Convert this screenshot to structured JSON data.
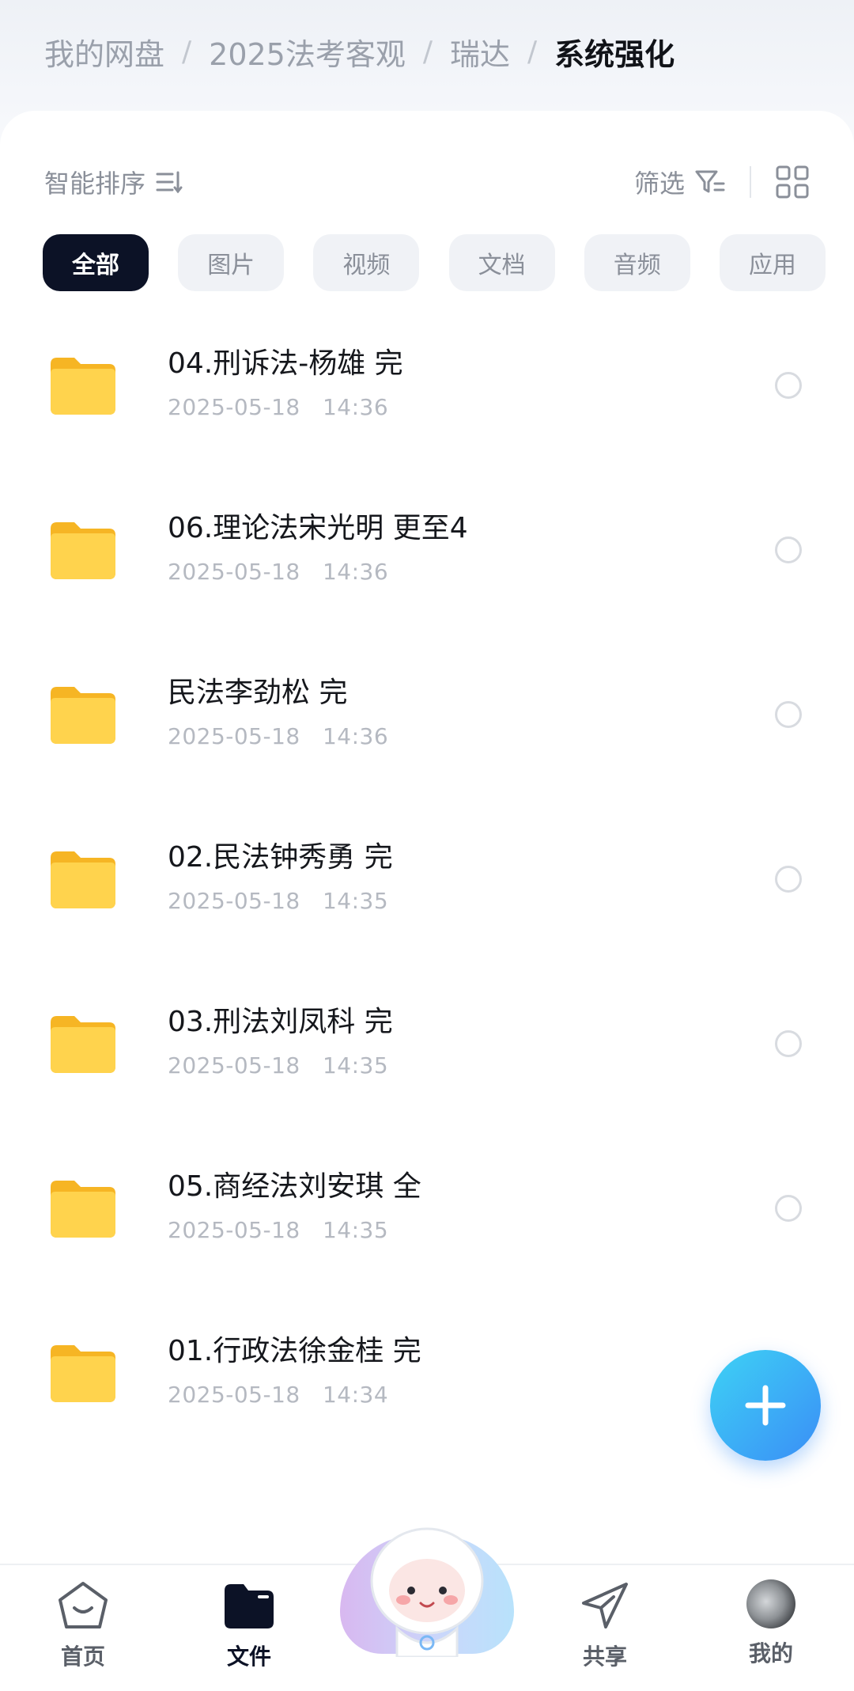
{
  "breadcrumb": {
    "items": [
      "我的网盘",
      "2025法考客观",
      "瑞达"
    ],
    "separator": "/",
    "current": "系统强化"
  },
  "toolbar": {
    "sort_label": "智能排序",
    "filter_label": "筛选"
  },
  "chips": [
    "全部",
    "图片",
    "视频",
    "文档",
    "音频",
    "应用"
  ],
  "files": [
    {
      "name": "04.刑诉法-杨雄 完",
      "date": "2025-05-18",
      "time": "14:36"
    },
    {
      "name": "06.理论法宋光明 更至4",
      "date": "2025-05-18",
      "time": "14:36"
    },
    {
      "name": "民法李劲松 完",
      "date": "2025-05-18",
      "time": "14:36"
    },
    {
      "name": "02.民法钟秀勇 完",
      "date": "2025-05-18",
      "time": "14:35"
    },
    {
      "name": "03.刑法刘凤科 完",
      "date": "2025-05-18",
      "time": "14:35"
    },
    {
      "name": "05.商经法刘安琪 全",
      "date": "2025-05-18",
      "time": "14:35"
    },
    {
      "name": "01.行政法徐金桂 完",
      "date": "2025-05-18",
      "time": "14:34"
    }
  ],
  "bottom_nav": {
    "home": "首页",
    "files": "文件",
    "share": "共享",
    "mine": "我的"
  },
  "icons": {
    "folder": "folder-icon",
    "fab": "plus-icon"
  },
  "colors": {
    "accent": "#3a8ef6",
    "active_chip": "#0c1226",
    "folder": "#fcc93a"
  }
}
